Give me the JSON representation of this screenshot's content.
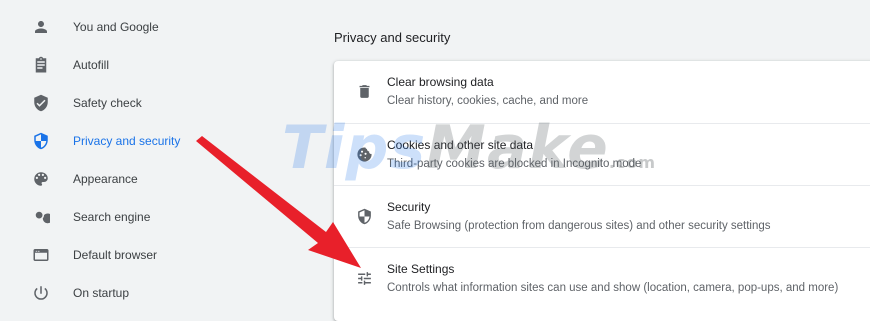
{
  "sidebar": {
    "items": [
      {
        "label": "You and Google",
        "icon": "person-icon"
      },
      {
        "label": "Autofill",
        "icon": "clipboard-icon"
      },
      {
        "label": "Safety check",
        "icon": "shield-check-icon"
      },
      {
        "label": "Privacy and security",
        "icon": "shield-icon",
        "active": true
      },
      {
        "label": "Appearance",
        "icon": "palette-icon"
      },
      {
        "label": "Search engine",
        "icon": "search-icon"
      },
      {
        "label": "Default browser",
        "icon": "browser-window-icon"
      },
      {
        "label": "On startup",
        "icon": "power-icon"
      }
    ]
  },
  "main": {
    "section_title": "Privacy and security",
    "rows": [
      {
        "title": "Clear browsing data",
        "description": "Clear history, cookies, cache, and more",
        "icon": "trash-icon"
      },
      {
        "title": "Cookies and other site data",
        "description": "Third-party cookies are blocked in Incognito mode",
        "icon": "cookie-icon"
      },
      {
        "title": "Security",
        "description": "Safe Browsing (protection from dangerous sites) and other security settings",
        "icon": "shield-icon"
      },
      {
        "title": "Site Settings",
        "description": "Controls what information sites can use and show (location, camera, pop-ups, and more)",
        "icon": "sliders-icon"
      }
    ]
  },
  "watermark": {
    "part1": "Tips",
    "part2": "Make",
    "suffix": ".com"
  },
  "colors": {
    "accent": "#1a73e8",
    "arrow": "#e8202a",
    "background": "#f1f3f4"
  }
}
